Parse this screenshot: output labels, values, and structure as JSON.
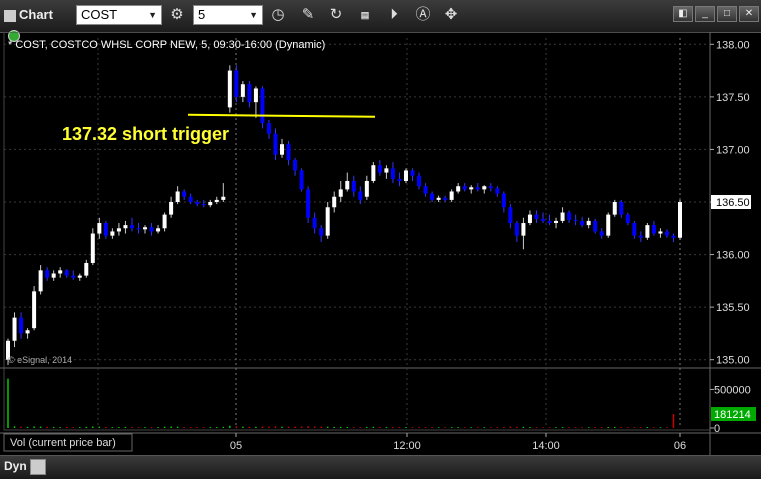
{
  "toolbar": {
    "chart_label": "Chart",
    "symbol_value": "COST",
    "interval_value": "5",
    "icons": [
      "chart-icon",
      "gear-icon",
      "clock-icon",
      "pencil-icon",
      "cursor-icon",
      "gcc-icon",
      "play-icon",
      "a-icon",
      "link-icon"
    ],
    "window_buttons": [
      "restore",
      "minimize",
      "maximize",
      "close"
    ]
  },
  "chart_title": "* COST, COSTCO WHSL CORP NEW, 5, 09:30-16:00 (Dynamic)",
  "copyright": "© eSignal, 2014",
  "annotation": "137.32 short trigger",
  "last_price_label": "136.50",
  "volume_pane_label": "Vol (current price bar)",
  "last_volume_label": "181214",
  "status": {
    "dyn_label": "Dyn"
  },
  "colors": {
    "up": "#ffffff",
    "down": "#0000ff",
    "trigger": "#ffff00",
    "vol_up": "#00cc00",
    "vol_down": "#cc0000",
    "last_price_box": "#ffffff",
    "last_vol_box": "#00aa00"
  },
  "chart_data": {
    "type": "candlestick",
    "price_axis": {
      "ticks": [
        "138.00",
        "137.50",
        "137.00",
        "136.50",
        "136.00",
        "135.50",
        "135.00"
      ],
      "ylim": [
        134.94,
        138.06
      ]
    },
    "volume_axis": {
      "ticks": [
        "500000",
        "0"
      ],
      "ylim": [
        0,
        700000
      ]
    },
    "x_ticks": [
      "14:00",
      "05",
      "12:00",
      "14:00",
      "06"
    ],
    "trigger_level": 137.32,
    "last_price": 136.5,
    "last_volume": 181214,
    "candles": [
      [
        135.0,
        135.2,
        134.95,
        135.18
      ],
      [
        135.18,
        135.45,
        135.12,
        135.4
      ],
      [
        135.4,
        135.45,
        135.2,
        135.25
      ],
      [
        135.25,
        135.3,
        135.2,
        135.28
      ],
      [
        135.3,
        135.7,
        135.28,
        135.65
      ],
      [
        135.65,
        135.9,
        135.62,
        135.85
      ],
      [
        135.85,
        135.88,
        135.75,
        135.78
      ],
      [
        135.78,
        135.85,
        135.75,
        135.82
      ],
      [
        135.82,
        135.88,
        135.78,
        135.85
      ],
      [
        135.85,
        135.86,
        135.78,
        135.8
      ],
      [
        135.8,
        135.85,
        135.76,
        135.78
      ],
      [
        135.78,
        135.82,
        135.75,
        135.8
      ],
      [
        135.8,
        135.95,
        135.78,
        135.92
      ],
      [
        135.92,
        136.25,
        135.9,
        136.2
      ],
      [
        136.2,
        136.35,
        136.15,
        136.3
      ],
      [
        136.3,
        136.32,
        136.15,
        136.18
      ],
      [
        136.18,
        136.25,
        136.15,
        136.22
      ],
      [
        136.22,
        136.3,
        136.18,
        136.25
      ],
      [
        136.25,
        136.32,
        136.2,
        136.28
      ],
      [
        136.28,
        136.35,
        136.22,
        136.25
      ],
      [
        136.25,
        136.3,
        136.2,
        136.24
      ],
      [
        136.24,
        136.28,
        136.2,
        136.26
      ],
      [
        136.26,
        136.3,
        136.18,
        136.22
      ],
      [
        136.22,
        136.28,
        136.2,
        136.25
      ],
      [
        136.25,
        136.4,
        136.22,
        136.38
      ],
      [
        136.38,
        136.55,
        136.35,
        136.5
      ],
      [
        136.5,
        136.65,
        136.48,
        136.6
      ],
      [
        136.6,
        136.62,
        136.52,
        136.55
      ],
      [
        136.55,
        136.58,
        136.48,
        136.5
      ],
      [
        136.5,
        136.52,
        136.46,
        136.48
      ],
      [
        136.48,
        136.52,
        136.45,
        136.47
      ],
      [
        136.47,
        136.52,
        136.45,
        136.5
      ],
      [
        136.5,
        136.55,
        136.48,
        136.52
      ],
      [
        136.52,
        136.68,
        136.5,
        136.55
      ],
      [
        137.4,
        137.8,
        137.35,
        137.75
      ],
      [
        137.75,
        137.8,
        137.45,
        137.5
      ],
      [
        137.5,
        137.65,
        137.45,
        137.62
      ],
      [
        137.62,
        137.65,
        137.4,
        137.45
      ],
      [
        137.45,
        137.6,
        137.3,
        137.58
      ],
      [
        137.58,
        137.6,
        137.2,
        137.25
      ],
      [
        137.25,
        137.28,
        137.1,
        137.15
      ],
      [
        137.15,
        137.2,
        136.9,
        136.95
      ],
      [
        136.95,
        137.1,
        136.92,
        137.05
      ],
      [
        137.05,
        137.08,
        136.85,
        136.9
      ],
      [
        136.9,
        136.92,
        136.75,
        136.8
      ],
      [
        136.8,
        136.82,
        136.6,
        136.62
      ],
      [
        136.62,
        136.65,
        136.3,
        136.35
      ],
      [
        136.35,
        136.4,
        136.2,
        136.25
      ],
      [
        136.25,
        136.28,
        136.12,
        136.18
      ],
      [
        136.18,
        136.5,
        136.15,
        136.45
      ],
      [
        136.45,
        136.6,
        136.4,
        136.55
      ],
      [
        136.55,
        136.7,
        136.5,
        136.62
      ],
      [
        136.62,
        136.78,
        136.6,
        136.7
      ],
      [
        136.7,
        136.75,
        136.55,
        136.6
      ],
      [
        136.6,
        136.65,
        136.48,
        136.52
      ],
      [
        136.55,
        136.75,
        136.52,
        136.7
      ],
      [
        136.7,
        136.88,
        136.68,
        136.85
      ],
      [
        136.85,
        136.9,
        136.75,
        136.78
      ],
      [
        136.78,
        136.85,
        136.72,
        136.82
      ],
      [
        136.82,
        136.88,
        136.68,
        136.72
      ],
      [
        136.72,
        136.78,
        136.65,
        136.7
      ],
      [
        136.7,
        136.82,
        136.68,
        136.8
      ],
      [
        136.8,
        136.82,
        136.7,
        136.75
      ],
      [
        136.75,
        136.78,
        136.62,
        136.65
      ],
      [
        136.65,
        136.68,
        136.55,
        136.58
      ],
      [
        136.58,
        136.6,
        136.5,
        136.52
      ],
      [
        136.52,
        136.56,
        136.5,
        136.54
      ],
      [
        136.54,
        136.56,
        136.5,
        136.52
      ],
      [
        136.52,
        136.62,
        136.5,
        136.6
      ],
      [
        136.6,
        136.68,
        136.58,
        136.65
      ],
      [
        136.65,
        136.68,
        136.6,
        136.62
      ],
      [
        136.62,
        136.66,
        136.58,
        136.64
      ],
      [
        136.64,
        136.68,
        136.6,
        136.62
      ],
      [
        136.62,
        136.66,
        136.58,
        136.65
      ],
      [
        136.65,
        136.68,
        136.6,
        136.63
      ],
      [
        136.63,
        136.65,
        136.55,
        136.58
      ],
      [
        136.58,
        136.6,
        136.4,
        136.45
      ],
      [
        136.45,
        136.48,
        136.25,
        136.3
      ],
      [
        136.3,
        136.32,
        136.12,
        136.18
      ],
      [
        136.18,
        136.35,
        136.05,
        136.3
      ],
      [
        136.3,
        136.42,
        136.28,
        136.38
      ],
      [
        136.38,
        136.42,
        136.3,
        136.34
      ],
      [
        136.34,
        136.4,
        136.3,
        136.32
      ],
      [
        136.32,
        136.38,
        136.28,
        136.3
      ],
      [
        136.3,
        136.35,
        136.25,
        136.32
      ],
      [
        136.32,
        136.45,
        136.3,
        136.4
      ],
      [
        136.4,
        136.42,
        136.3,
        136.33
      ],
      [
        136.33,
        136.38,
        136.28,
        136.32
      ],
      [
        136.32,
        136.36,
        136.26,
        136.28
      ],
      [
        136.28,
        136.35,
        136.25,
        136.32
      ],
      [
        136.32,
        136.34,
        136.2,
        136.22
      ],
      [
        136.22,
        136.25,
        136.15,
        136.18
      ],
      [
        136.18,
        136.4,
        136.16,
        136.38
      ],
      [
        136.38,
        136.52,
        136.36,
        136.5
      ],
      [
        136.5,
        136.52,
        136.35,
        136.38
      ],
      [
        136.38,
        136.4,
        136.28,
        136.3
      ],
      [
        136.3,
        136.32,
        136.15,
        136.18
      ],
      [
        136.18,
        136.22,
        136.12,
        136.16
      ],
      [
        136.16,
        136.3,
        136.14,
        136.28
      ],
      [
        136.28,
        136.32,
        136.18,
        136.2
      ],
      [
        136.2,
        136.25,
        136.16,
        136.22
      ],
      [
        136.22,
        136.24,
        136.16,
        136.18
      ],
      [
        136.18,
        136.2,
        136.12,
        136.16
      ],
      [
        136.16,
        136.52,
        136.14,
        136.5
      ]
    ],
    "volume": [
      640000,
      22000,
      18000,
      15000,
      20000,
      18000,
      16000,
      14000,
      12000,
      13000,
      11000,
      12000,
      15000,
      20000,
      18000,
      14000,
      12000,
      13000,
      14000,
      12000,
      11000,
      12000,
      13000,
      12000,
      16000,
      20000,
      18000,
      14000,
      12000,
      11000,
      10000,
      11000,
      12000,
      16000,
      30000,
      22000,
      18000,
      15000,
      16000,
      20000,
      18000,
      22000,
      16000,
      17000,
      18000,
      20000,
      24000,
      20000,
      18000,
      17000,
      15000,
      14000,
      13000,
      12000,
      12000,
      14000,
      16000,
      13000,
      12000,
      13000,
      12000,
      13000,
      12000,
      11000,
      12000,
      11000,
      10000,
      10000,
      11000,
      12000,
      10000,
      10000,
      11000,
      10000,
      10000,
      11000,
      14000,
      18000,
      16000,
      15000,
      12000,
      11000,
      10000,
      10000,
      11000,
      12000,
      11000,
      10000,
      10000,
      11000,
      12000,
      12000,
      13000,
      14000,
      12000,
      11000,
      12000,
      11000,
      13000,
      11000,
      10000,
      10000,
      181214
    ]
  }
}
